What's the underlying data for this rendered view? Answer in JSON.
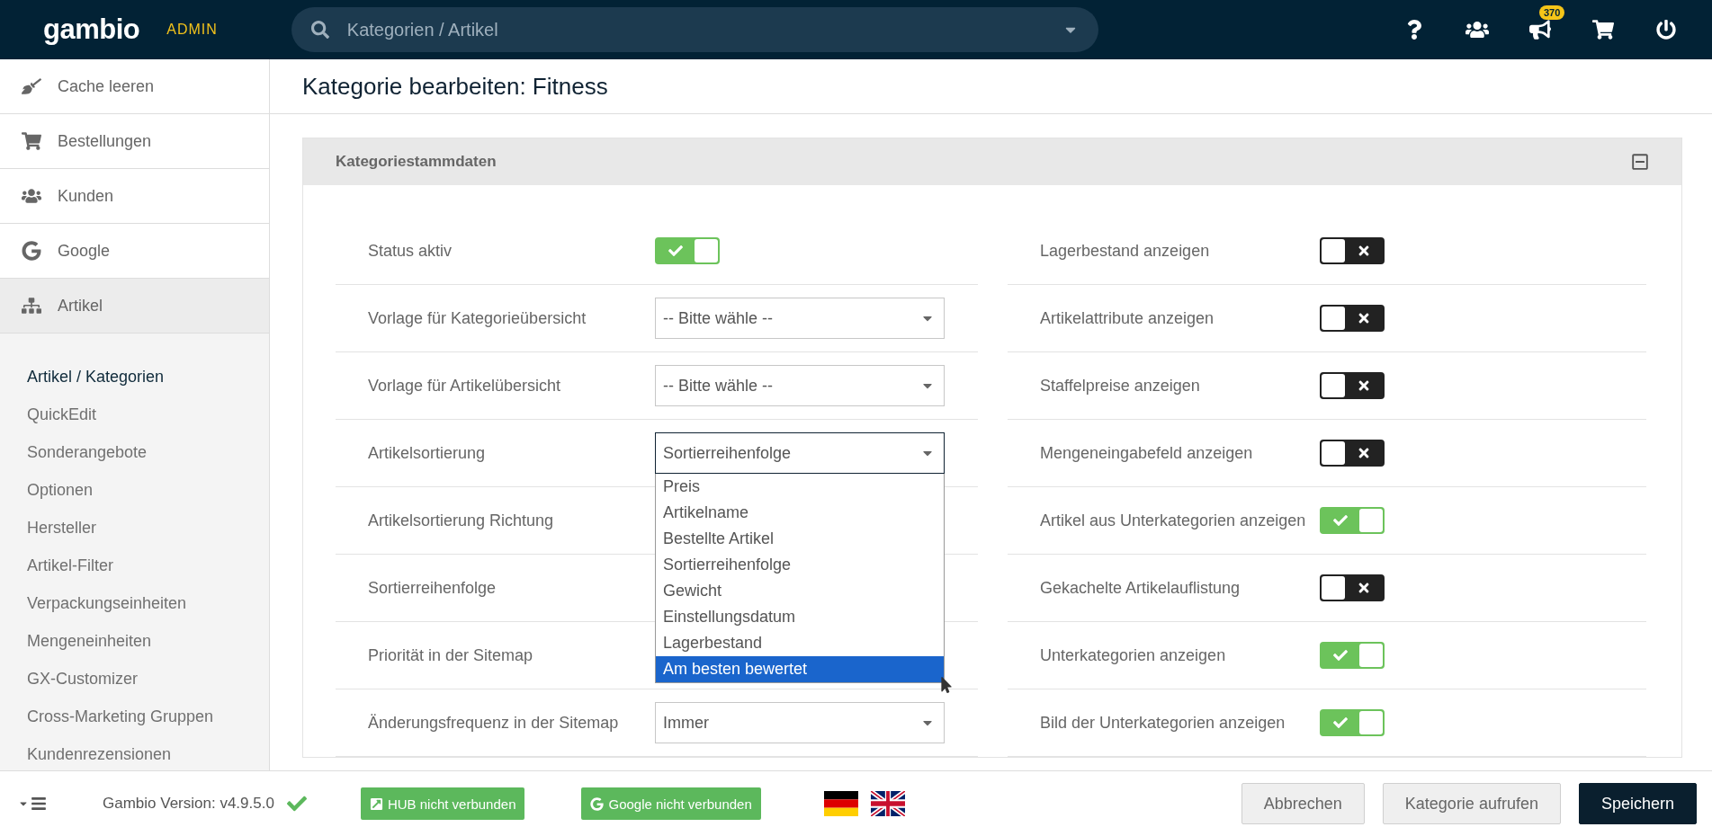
{
  "topbar": {
    "logo": "gambio",
    "logo_badge": "ADMIN",
    "search": {
      "placeholder": "Kategorien / Artikel"
    },
    "notification_count": "370"
  },
  "sidebar": {
    "items": [
      {
        "label": "Cache leeren",
        "selected": false
      },
      {
        "label": "Bestellungen",
        "selected": false
      },
      {
        "label": "Kunden",
        "selected": false
      },
      {
        "label": "Google",
        "selected": false
      },
      {
        "label": "Artikel",
        "selected": true
      }
    ],
    "sub_items": [
      {
        "label": "Artikel / Kategorien",
        "selected": true
      },
      {
        "label": "QuickEdit",
        "selected": false
      },
      {
        "label": "Sonderangebote",
        "selected": false
      },
      {
        "label": "Optionen",
        "selected": false
      },
      {
        "label": "Hersteller",
        "selected": false
      },
      {
        "label": "Artikel-Filter",
        "selected": false
      },
      {
        "label": "Verpackungseinheiten",
        "selected": false
      },
      {
        "label": "Mengeneinheiten",
        "selected": false
      },
      {
        "label": "GX-Customizer",
        "selected": false
      },
      {
        "label": "Cross-Marketing Gruppen",
        "selected": false
      },
      {
        "label": "Kundenrezensionen",
        "selected": false
      }
    ]
  },
  "page": {
    "title": "Kategorie bearbeiten: Fitness"
  },
  "panel": {
    "title": "Kategoriestammdaten",
    "left_fields": [
      {
        "label": "Status aktiv",
        "kind": "toggle",
        "on": true
      },
      {
        "label": "Vorlage für Kategorieübersicht",
        "kind": "select",
        "value": "-- Bitte wähle --",
        "expanded": false
      },
      {
        "label": "Vorlage für Artikelübersicht",
        "kind": "select",
        "value": "-- Bitte wähle --",
        "expanded": false
      },
      {
        "label": "Artikelsortierung",
        "kind": "select",
        "value": "Sortierreihenfolge",
        "expanded": true,
        "options": [
          {
            "label": "Preis",
            "highlighted": false
          },
          {
            "label": "Artikelname",
            "highlighted": false
          },
          {
            "label": "Bestellte Artikel",
            "highlighted": false
          },
          {
            "label": "Sortierreihenfolge",
            "highlighted": false
          },
          {
            "label": "Gewicht",
            "highlighted": false
          },
          {
            "label": "Einstellungsdatum",
            "highlighted": false
          },
          {
            "label": "Lagerbestand",
            "highlighted": false
          },
          {
            "label": "Am besten bewertet",
            "highlighted": true
          }
        ]
      },
      {
        "label": "Artikelsortierung Richtung",
        "kind": "covered"
      },
      {
        "label": "Sortierreihenfolge",
        "kind": "covered"
      },
      {
        "label": "Priorität in der Sitemap",
        "kind": "covered"
      },
      {
        "label": "Änderungsfrequenz in der Sitemap",
        "kind": "select",
        "value": "Immer",
        "expanded": false
      }
    ],
    "right_fields": [
      {
        "label": "Lagerbestand anzeigen",
        "on": false
      },
      {
        "label": "Artikelattribute anzeigen",
        "on": false
      },
      {
        "label": "Staffelpreise anzeigen",
        "on": false
      },
      {
        "label": "Mengeneingabefeld anzeigen",
        "on": false
      },
      {
        "label": "Artikel aus Unterkategorien anzeigen",
        "on": true
      },
      {
        "label": "Gekachelte Artikelauflistung",
        "on": false
      },
      {
        "label": "Unterkategorien anzeigen",
        "on": true
      },
      {
        "label": "Bild der Unterkategorien anzeigen",
        "on": true
      }
    ]
  },
  "footer": {
    "version": "Gambio Version: v4.9.5.0",
    "status_buttons": [
      "HUB nicht verbunden",
      "Google nicht verbunden"
    ],
    "buttons": [
      {
        "label": "Abbrechen",
        "kind": "secondary"
      },
      {
        "label": "Kategorie aufrufen",
        "kind": "secondary"
      },
      {
        "label": "Speichern",
        "kind": "primary"
      }
    ]
  }
}
